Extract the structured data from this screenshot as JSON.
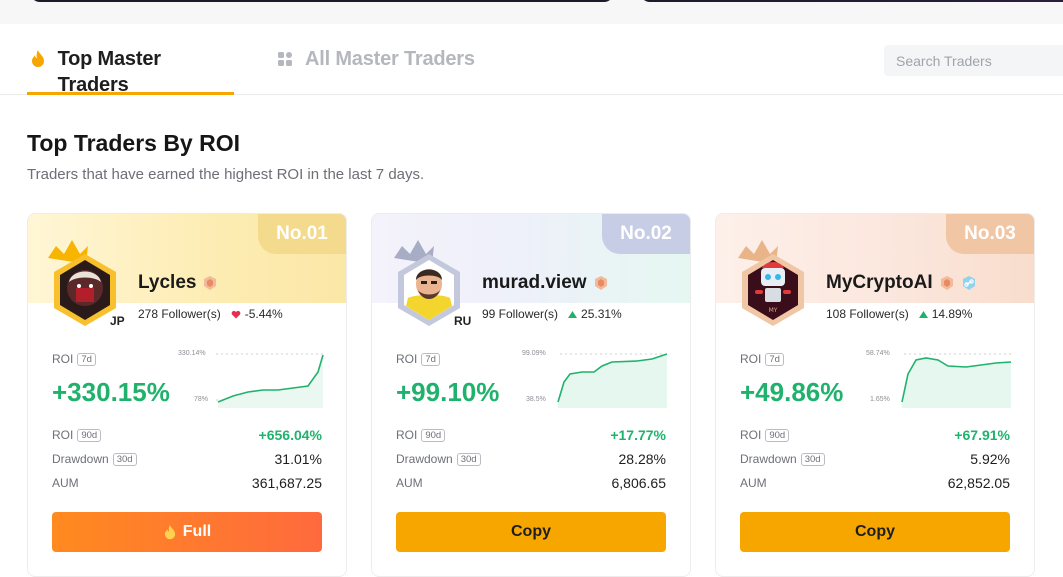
{
  "tabs": {
    "top_label": "Top Master Traders",
    "all_label": "All Master Traders"
  },
  "search": {
    "placeholder": "Search Traders"
  },
  "section": {
    "title": "Top Traders By ROI",
    "subtitle": "Traders that have earned the highest ROI in the last 7 days."
  },
  "colors": {
    "accent": "#f7a600",
    "positive": "#20b26c",
    "negative": "#e5304f"
  },
  "traders": [
    {
      "rank": "No.01",
      "name": "Lycles",
      "country": "JP",
      "followers": "278 Follower(s)",
      "change": "-5.44%",
      "change_dir": "down",
      "roi_7d_label": "ROI",
      "roi_7d_period": "7d",
      "roi_7d": "+330.15%",
      "spark_hi": "330.14%",
      "spark_lo": "78%",
      "roi_90d_label": "ROI",
      "roi_90d_period": "90d",
      "roi_90d": "+656.04%",
      "drawdown_label": "Drawdown",
      "drawdown_period": "30d",
      "drawdown": "31.01%",
      "aum_label": "AUM",
      "aum": "361,687.25",
      "button": "Full"
    },
    {
      "rank": "No.02",
      "name": "murad.view",
      "country": "RU",
      "followers": "99 Follower(s)",
      "change": "25.31%",
      "change_dir": "up",
      "roi_7d_label": "ROI",
      "roi_7d_period": "7d",
      "roi_7d": "+99.10%",
      "spark_hi": "99.09%",
      "spark_lo": "38.5%",
      "roi_90d_label": "ROI",
      "roi_90d_period": "90d",
      "roi_90d": "+17.77%",
      "drawdown_label": "Drawdown",
      "drawdown_period": "30d",
      "drawdown": "28.28%",
      "aum_label": "AUM",
      "aum": "6,806.65",
      "button": "Copy"
    },
    {
      "rank": "No.03",
      "name": "MyCryptoAI",
      "country": "",
      "followers": "108 Follower(s)",
      "change": "14.89%",
      "change_dir": "up",
      "roi_7d_label": "ROI",
      "roi_7d_period": "7d",
      "roi_7d": "+49.86%",
      "spark_hi": "58.74%",
      "spark_lo": "1.65%",
      "roi_90d_label": "ROI",
      "roi_90d_period": "90d",
      "roi_90d": "+67.91%",
      "drawdown_label": "Drawdown",
      "drawdown_period": "30d",
      "drawdown": "5.92%",
      "aum_label": "AUM",
      "aum": "62,852.05",
      "button": "Copy"
    }
  ],
  "icons": {
    "tab_top": "fire-icon",
    "tab_all": "grid-icon",
    "badge": "shield-badge-icon",
    "link": "link-badge-icon"
  }
}
